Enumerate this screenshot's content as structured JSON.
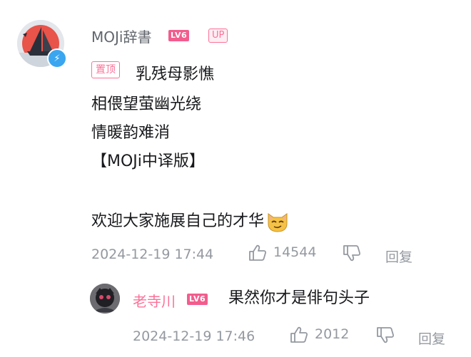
{
  "comment": {
    "username": "MOJi辞書",
    "level_badge": "LV6",
    "up_badge": "UP",
    "pinned_badge": "置顶",
    "lines": [
      "乳残母影憔",
      "相偎望萤幽光绕",
      "情暖韵难消",
      "【MOJi中译版】",
      "欢迎大家施展自己的才华"
    ],
    "timestamp": "2024-12-19 17:44",
    "like_count": "14544",
    "reply_label": "回复",
    "icons": [
      "lightning-icon",
      "thumbs-up-icon",
      "thumbs-down-icon",
      "cat-emoji-icon"
    ]
  },
  "reply": {
    "username": "老寺川",
    "level_badge": "LV6",
    "text": "果然你才是俳句头子",
    "timestamp": "2024-12-19 17:46",
    "like_count": "2012",
    "reply_label": "回复"
  },
  "colors": {
    "accent_pink": "#fb7299",
    "meta_gray": "#9499a0",
    "verify_blue": "#3aa6f0"
  }
}
